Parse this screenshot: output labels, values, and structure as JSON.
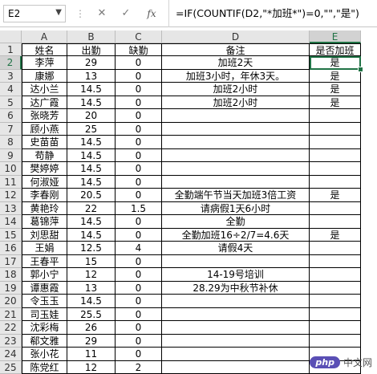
{
  "formula_bar": {
    "name_box": "E2",
    "cancel_glyph": "✕",
    "enter_glyph": "✓",
    "fx_label": "fx",
    "formula": "=IF(COUNTIF(D2,\"*加班*\")=0,\"\",\"是\")"
  },
  "sheet": {
    "columns": [
      "A",
      "B",
      "C",
      "D",
      "E"
    ],
    "selected_column": "E",
    "selected_row": 2,
    "rows": [
      {
        "num": "1",
        "cells": [
          "姓名",
          "出勤",
          "缺勤",
          "备注",
          "是否加班"
        ]
      },
      {
        "num": "2",
        "cells": [
          "李萍",
          "29",
          "0",
          "加班2天",
          "是"
        ]
      },
      {
        "num": "3",
        "cells": [
          "康娜",
          "13",
          "0",
          "加班3小时，年休3天。",
          "是"
        ]
      },
      {
        "num": "4",
        "cells": [
          "达小兰",
          "14.5",
          "0",
          "加班2小时",
          "是"
        ]
      },
      {
        "num": "5",
        "cells": [
          "达广霞",
          "14.5",
          "0",
          "加班2小时",
          "是"
        ]
      },
      {
        "num": "6",
        "cells": [
          "张晓芳",
          "20",
          "0",
          "",
          ""
        ]
      },
      {
        "num": "7",
        "cells": [
          "顾小燕",
          "25",
          "0",
          "",
          ""
        ]
      },
      {
        "num": "8",
        "cells": [
          "史苗苗",
          "14.5",
          "0",
          "",
          ""
        ]
      },
      {
        "num": "9",
        "cells": [
          "苟静",
          "14.5",
          "0",
          "",
          ""
        ]
      },
      {
        "num": "10",
        "cells": [
          "樊婷婷",
          "14.5",
          "0",
          "",
          ""
        ]
      },
      {
        "num": "11",
        "cells": [
          "何淑娅",
          "14.5",
          "0",
          "",
          ""
        ]
      },
      {
        "num": "12",
        "cells": [
          "李春刚",
          "20.5",
          "0",
          "全勤端午节当天加班3倍工资",
          "是"
        ]
      },
      {
        "num": "13",
        "cells": [
          "黄艳玲",
          "22",
          "1.5",
          "请病假1天6小时",
          ""
        ]
      },
      {
        "num": "14",
        "cells": [
          "葛锦萍",
          "14.5",
          "0",
          "全勤",
          ""
        ]
      },
      {
        "num": "15",
        "cells": [
          "刘思甜",
          "14.5",
          "0",
          "全勤加班16÷2/7=4.6天",
          "是"
        ]
      },
      {
        "num": "16",
        "cells": [
          "王娟",
          "12.5",
          "4",
          "请假4天",
          ""
        ]
      },
      {
        "num": "17",
        "cells": [
          "王春平",
          "15",
          "0",
          "",
          ""
        ]
      },
      {
        "num": "18",
        "cells": [
          "郭小宁",
          "12",
          "0",
          "14-19号培训",
          ""
        ]
      },
      {
        "num": "19",
        "cells": [
          "谭惠霞",
          "13",
          "0",
          "28.29为中秋节补休",
          ""
        ]
      },
      {
        "num": "20",
        "cells": [
          "令玉玉",
          "14.5",
          "0",
          "",
          ""
        ]
      },
      {
        "num": "21",
        "cells": [
          "司玉娃",
          "25.5",
          "0",
          "",
          ""
        ]
      },
      {
        "num": "22",
        "cells": [
          "沈彩梅",
          "26",
          "0",
          "",
          ""
        ]
      },
      {
        "num": "23",
        "cells": [
          "郗文雅",
          "29",
          "0",
          "",
          ""
        ]
      },
      {
        "num": "24",
        "cells": [
          "张小花",
          "11",
          "0",
          "",
          ""
        ]
      },
      {
        "num": "25",
        "cells": [
          "陈党红",
          "12",
          "2",
          "",
          ""
        ]
      }
    ]
  },
  "watermark": {
    "badge": "php",
    "text": "中文网"
  },
  "colors": {
    "accent": "#217346",
    "header_bg": "#e6e6e6"
  }
}
